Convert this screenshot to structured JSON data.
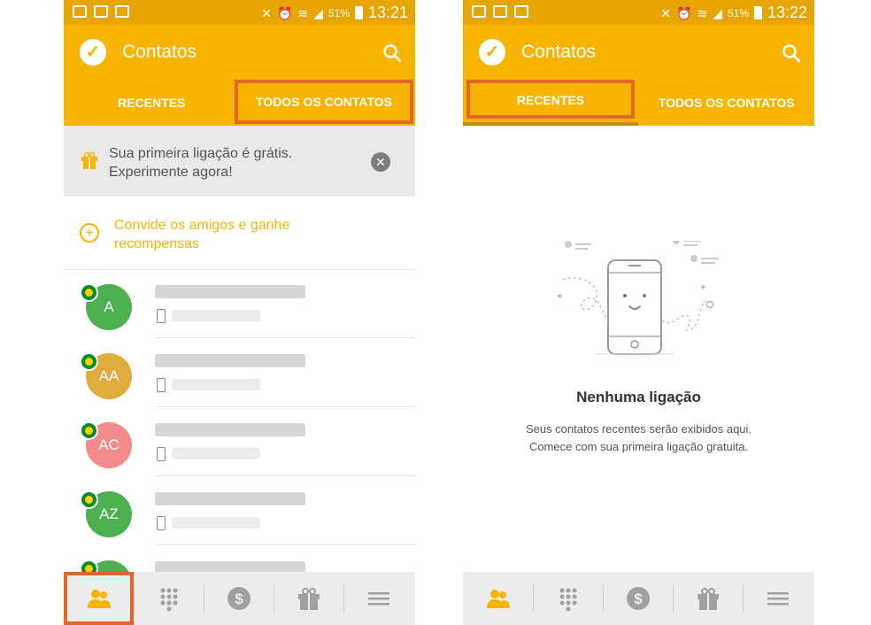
{
  "left": {
    "status": {
      "battery": "51%",
      "time": "13:21"
    },
    "appbar": {
      "title": "Contatos"
    },
    "tabs": [
      {
        "label": "RECENTES"
      },
      {
        "label": "TODOS OS CONTATOS"
      }
    ],
    "promo": {
      "line1": "Sua primeira ligação é grátis.",
      "line2": "Experimente agora!"
    },
    "invite": {
      "line1": "Convide os amigos e ganhe",
      "line2": "recompensas"
    },
    "contacts": [
      {
        "initials": "A",
        "color": "#4caf50"
      },
      {
        "initials": "AA",
        "color": "#e0ac3c"
      },
      {
        "initials": "AC",
        "color": "#f58a8a"
      },
      {
        "initials": "AZ",
        "color": "#4caf50"
      }
    ]
  },
  "right": {
    "status": {
      "battery": "51%",
      "time": "13:22"
    },
    "appbar": {
      "title": "Contatos"
    },
    "tabs": [
      {
        "label": "RECENTES"
      },
      {
        "label": "TODOS OS CONTATOS"
      }
    ],
    "empty": {
      "title": "Nenhuma ligação",
      "line1": "Seus contatos recentes serão exibidos aqui.",
      "line2": "Comece com sua primeira ligação gratuita."
    }
  },
  "nav_icons": [
    "contacts-icon",
    "dialpad-icon",
    "credit-icon",
    "gift-icon",
    "menu-icon"
  ],
  "colors": {
    "accent": "#f7b400",
    "highlight": "#e3662a",
    "status_bar": "#e6a500"
  }
}
